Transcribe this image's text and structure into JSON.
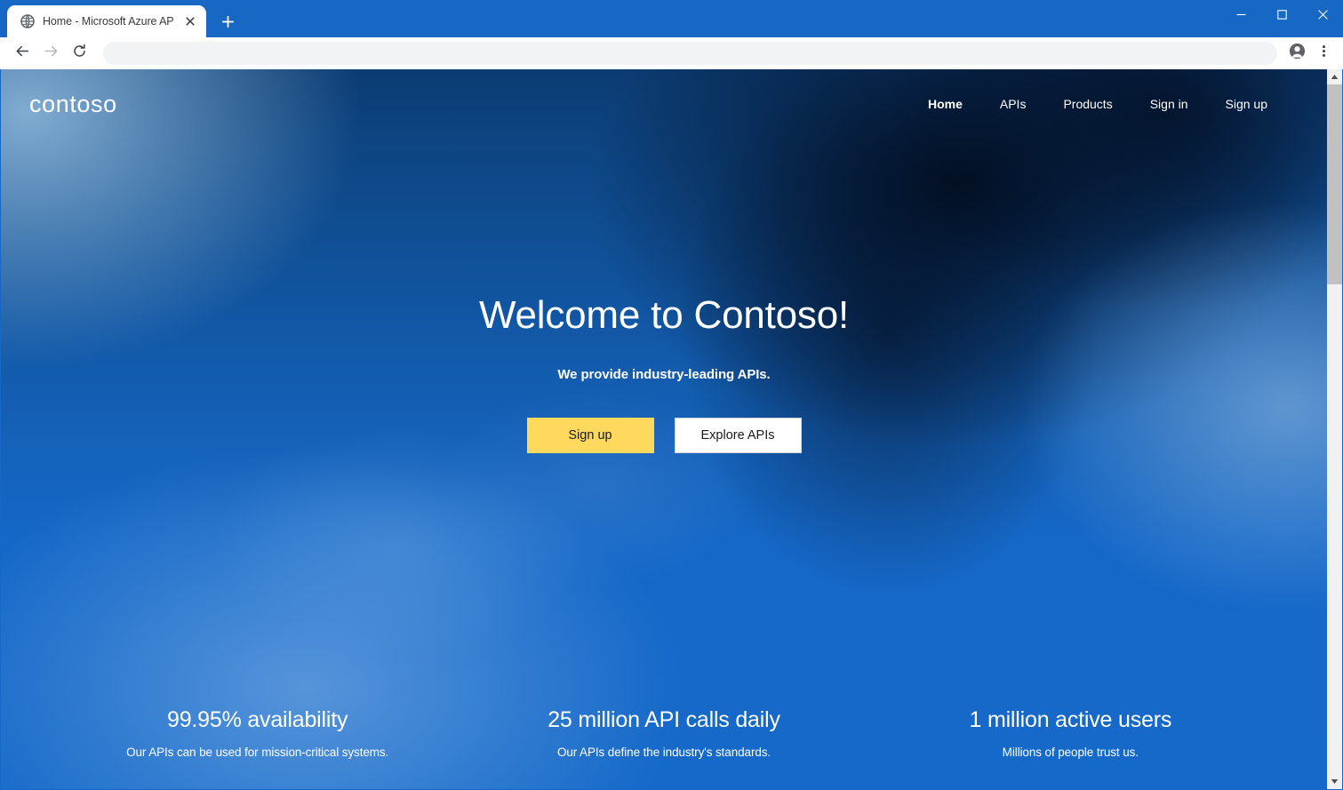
{
  "browser": {
    "tab": {
      "favicon_icon": "globe-icon",
      "title": "Home - Microsoft Azure API Man",
      "close_icon": "close-icon"
    },
    "new_tab_icon": "plus-icon",
    "window_controls": {
      "minimize_icon": "minimize-icon",
      "maximize_icon": "maximize-icon",
      "close_icon": "close-icon"
    },
    "toolbar": {
      "back_icon": "back-arrow-icon",
      "forward_icon": "forward-arrow-icon",
      "reload_icon": "reload-icon",
      "address_value": "",
      "address_placeholder": "",
      "profile_icon": "account-avatar-icon",
      "menu_icon": "three-dot-menu-icon"
    }
  },
  "site": {
    "brand": "contoso",
    "nav": [
      {
        "label": "Home",
        "active": true
      },
      {
        "label": "APIs",
        "active": false
      },
      {
        "label": "Products",
        "active": false
      },
      {
        "label": "Sign in",
        "active": false
      },
      {
        "label": "Sign up",
        "active": false
      }
    ],
    "hero": {
      "title": "Welcome to Contoso!",
      "subtitle": "We provide industry-leading APIs.",
      "primary_button": "Sign up",
      "secondary_button": "Explore APIs"
    },
    "stats": [
      {
        "value": "99.95% availability",
        "description": "Our APIs can be used for mission-critical systems."
      },
      {
        "value": "25 million API calls daily",
        "description": "Our APIs define the industry's standards."
      },
      {
        "value": "1 million active users",
        "description": "Millions of people trust us."
      }
    ]
  },
  "scrollbar": {
    "up_icon": "scroll-up-arrow-icon",
    "down_icon": "scroll-down-arrow-icon"
  },
  "colors": {
    "browser_chrome": "#1668c4",
    "accent_yellow": "#ffd95e",
    "hero_blue": "#1568c8",
    "hero_dark": "#041128"
  }
}
